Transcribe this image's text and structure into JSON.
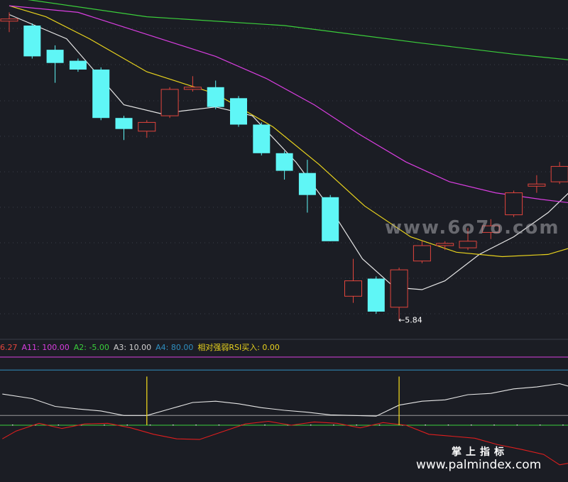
{
  "colors": {
    "background": "#1b1d24",
    "grid": "#3a3d47",
    "up": "#e2453c",
    "down": "#5ff6f6",
    "ma_white": "#e6e6e6",
    "ma_yellow": "#e8d21d",
    "ma_magenta": "#d93ee0",
    "ma_green": "#3bcf3b",
    "rsi_white": "#e6e6e6",
    "rsi_red": "#e01e1e",
    "line_magenta": "#d93ee0",
    "line_blue": "#2f8fc0",
    "line_gray": "#9a9a9a",
    "line_green": "#3bcf3b",
    "signal": "#e8d21d"
  },
  "indicator_bar": [
    {
      "label": "6.27",
      "color": "#e2453c"
    },
    {
      "label": "A11: 100.00",
      "color": "#d93ee0"
    },
    {
      "label": "A2: -5.00",
      "color": "#3bcf3b"
    },
    {
      "label": "A3: 10.00",
      "color": "#d0d0d0"
    },
    {
      "label": "A4: 80.00",
      "color": "#2f8fc0"
    },
    {
      "label": "相对强弱RSI买入: 0.00",
      "color": "#e8d21d"
    }
  ],
  "watermarks": {
    "center": "www.6o7o.com",
    "brand": "掌上指标",
    "url": "www.palmindex.com"
  },
  "chart_data": {
    "type": "candlestick",
    "price_range": [
      5.78,
      7.28
    ],
    "candles": [
      {
        "o": 7.2,
        "c": 7.21,
        "h": 7.24,
        "l": 7.15
      },
      {
        "o": 7.18,
        "c": 7.04,
        "h": 7.19,
        "l": 7.03
      },
      {
        "o": 7.07,
        "c": 7.01,
        "h": 7.09,
        "l": 6.92
      },
      {
        "o": 7.02,
        "c": 6.98,
        "h": 7.03,
        "l": 6.97
      },
      {
        "o": 6.98,
        "c": 6.76,
        "h": 6.99,
        "l": 6.75
      },
      {
        "o": 6.76,
        "c": 6.71,
        "h": 6.77,
        "l": 6.66
      },
      {
        "o": 6.7,
        "c": 6.74,
        "h": 6.75,
        "l": 6.67
      },
      {
        "o": 6.77,
        "c": 6.89,
        "h": 6.9,
        "l": 6.76
      },
      {
        "o": 6.89,
        "c": 6.9,
        "h": 6.95,
        "l": 6.88
      },
      {
        "o": 6.9,
        "c": 6.81,
        "h": 6.93,
        "l": 6.8
      },
      {
        "o": 6.85,
        "c": 6.73,
        "h": 6.86,
        "l": 6.72
      },
      {
        "o": 6.73,
        "c": 6.6,
        "h": 6.74,
        "l": 6.59
      },
      {
        "o": 6.6,
        "c": 6.52,
        "h": 6.61,
        "l": 6.48
      },
      {
        "o": 6.51,
        "c": 6.41,
        "h": 6.57,
        "l": 6.33
      },
      {
        "o": 6.4,
        "c": 6.2,
        "h": 6.41,
        "l": 6.2
      },
      {
        "o": 5.95,
        "c": 6.02,
        "h": 6.12,
        "l": 5.92
      },
      {
        "o": 6.03,
        "c": 5.88,
        "h": 6.04,
        "l": 5.87
      },
      {
        "o": 5.9,
        "c": 6.07,
        "h": 6.08,
        "l": 5.84
      },
      {
        "o": 6.11,
        "c": 6.18,
        "h": 6.2,
        "l": 6.1
      },
      {
        "o": 6.18,
        "c": 6.19,
        "h": 6.2,
        "l": 6.16
      },
      {
        "o": 6.17,
        "c": 6.2,
        "h": 6.26,
        "l": 6.16
      },
      {
        "o": 6.24,
        "c": 6.27,
        "h": 6.3,
        "l": 6.21
      },
      {
        "o": 6.32,
        "c": 6.42,
        "h": 6.43,
        "l": 6.31
      },
      {
        "o": 6.45,
        "c": 6.46,
        "h": 6.5,
        "l": 6.42
      },
      {
        "o": 6.47,
        "c": 6.54,
        "h": 6.56,
        "l": 6.46
      }
    ],
    "moving_averages": [
      {
        "color_key": "ma_white",
        "points": [
          [
            0,
            7.23
          ],
          [
            2.5,
            7.12
          ],
          [
            5,
            6.82
          ],
          [
            6.6,
            6.78
          ],
          [
            9,
            6.81
          ],
          [
            10.6,
            6.77
          ],
          [
            12.5,
            6.56
          ],
          [
            14,
            6.35
          ],
          [
            15.4,
            6.12
          ],
          [
            16.8,
            5.99
          ],
          [
            18,
            5.98
          ],
          [
            19,
            6.02
          ],
          [
            20.5,
            6.14
          ],
          [
            22,
            6.22
          ],
          [
            23.5,
            6.33
          ],
          [
            24.8,
            6.46
          ]
        ]
      },
      {
        "color_key": "ma_yellow",
        "points": [
          [
            0,
            7.27
          ],
          [
            1.6,
            7.22
          ],
          [
            3.5,
            7.12
          ],
          [
            6,
            6.97
          ],
          [
            9,
            6.87
          ],
          [
            11.5,
            6.72
          ],
          [
            13.5,
            6.55
          ],
          [
            15.5,
            6.36
          ],
          [
            17.5,
            6.22
          ],
          [
            19.5,
            6.15
          ],
          [
            21.5,
            6.13
          ],
          [
            23.5,
            6.14
          ],
          [
            24.8,
            6.18
          ]
        ]
      },
      {
        "color_key": "ma_magenta",
        "points": [
          [
            0,
            7.27
          ],
          [
            3,
            7.24
          ],
          [
            6,
            7.14
          ],
          [
            9,
            7.04
          ],
          [
            11.2,
            6.94
          ],
          [
            13.3,
            6.82
          ],
          [
            15.2,
            6.69
          ],
          [
            17.3,
            6.56
          ],
          [
            19.2,
            6.47
          ],
          [
            21.2,
            6.42
          ],
          [
            23.2,
            6.39
          ],
          [
            24.8,
            6.37
          ]
        ]
      },
      {
        "color_key": "ma_green",
        "points": [
          [
            0,
            7.31
          ],
          [
            6,
            7.22
          ],
          [
            12,
            7.18
          ],
          [
            18,
            7.1
          ],
          [
            22,
            7.05
          ],
          [
            24.8,
            7.02
          ]
        ]
      }
    ],
    "low_annotation": {
      "index": 17,
      "value": 5.84,
      "label": "←5.84"
    },
    "rsi": {
      "range": [
        -5,
        100
      ],
      "levels": [
        {
          "value": 100,
          "color_key": "line_magenta"
        },
        {
          "value": 80,
          "color_key": "line_blue"
        },
        {
          "value": 10,
          "color_key": "line_gray"
        },
        {
          "value": -5,
          "color_key": "line_green"
        }
      ],
      "series_white": [
        [
          -0.3,
          43
        ],
        [
          1,
          36
        ],
        [
          2,
          24
        ],
        [
          3,
          20
        ],
        [
          4,
          17
        ],
        [
          5,
          10
        ],
        [
          6,
          10
        ],
        [
          7,
          20
        ],
        [
          8,
          30
        ],
        [
          9,
          32
        ],
        [
          10,
          28
        ],
        [
          11,
          22
        ],
        [
          12,
          18
        ],
        [
          13,
          15
        ],
        [
          14,
          11
        ],
        [
          15,
          10
        ],
        [
          16,
          9
        ],
        [
          17,
          26
        ],
        [
          18,
          32
        ],
        [
          19,
          34
        ],
        [
          20,
          42
        ],
        [
          21,
          44
        ],
        [
          22,
          51
        ],
        [
          23,
          54
        ],
        [
          24,
          59
        ],
        [
          24.8,
          51
        ]
      ],
      "series_red": [
        [
          -0.3,
          -26
        ],
        [
          0.3,
          -14
        ],
        [
          1.3,
          -2
        ],
        [
          2.3,
          -10
        ],
        [
          3.3,
          -3
        ],
        [
          4.3,
          -2
        ],
        [
          5.3,
          -9
        ],
        [
          6.3,
          -19
        ],
        [
          7.3,
          -26
        ],
        [
          8.3,
          -27
        ],
        [
          9.3,
          -15
        ],
        [
          10.3,
          -3
        ],
        [
          11.3,
          1
        ],
        [
          12.3,
          -5
        ],
        [
          13.3,
          0
        ],
        [
          14.3,
          -2
        ],
        [
          15.3,
          -9
        ],
        [
          16.3,
          -1
        ],
        [
          17.3,
          -5
        ],
        [
          18.3,
          -19
        ],
        [
          19.3,
          -22
        ],
        [
          20.3,
          -25
        ],
        [
          21.3,
          -35
        ],
        [
          22.3,
          -42
        ],
        [
          23.3,
          -50
        ],
        [
          24.0,
          -66
        ],
        [
          24.8,
          -61
        ]
      ],
      "buy_signals": [
        {
          "x": 6,
          "low": -5,
          "high": 70
        },
        {
          "x": 17,
          "low": -5,
          "high": 70
        }
      ]
    }
  }
}
